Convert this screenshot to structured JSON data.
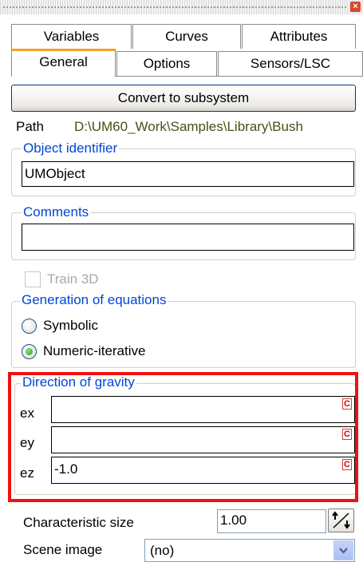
{
  "tabs": {
    "row1": [
      "Variables",
      "Curves",
      "Attributes"
    ],
    "row2": [
      "General",
      "Options",
      "Sensors/LSC"
    ],
    "active": "General"
  },
  "convert_button": "Convert to subsystem",
  "path": {
    "label": "Path",
    "value": "D:\\UM60_Work\\Samples\\Library\\Bush"
  },
  "object_identifier": {
    "legend": "Object identifier",
    "value": "UMObject"
  },
  "comments": {
    "legend": "Comments",
    "value": ""
  },
  "train3d": {
    "label": "Train 3D",
    "checked": false,
    "enabled": false
  },
  "generation": {
    "legend": "Generation of equations",
    "options": [
      "Symbolic",
      "Numeric-iterative"
    ],
    "selected": "Numeric-iterative"
  },
  "gravity": {
    "legend": "Direction of gravity",
    "ex": {
      "label": "ex",
      "value": ""
    },
    "ey": {
      "label": "ey",
      "value": ""
    },
    "ez": {
      "label": "ez",
      "value": "-1.0"
    },
    "c_mark": "C"
  },
  "characteristic_size": {
    "label": "Characteristic size",
    "value": "1.00"
  },
  "scene_image": {
    "label": "Scene image",
    "value": "(no)"
  },
  "colors": {
    "highlight": "#ee1111",
    "legend_text": "#0046d5",
    "active_tab_accent": "#f0a020"
  }
}
